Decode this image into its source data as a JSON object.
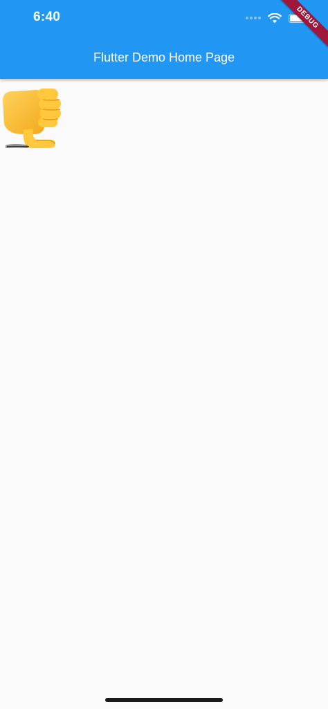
{
  "status_bar": {
    "time": "6:40",
    "icons": [
      "cellular-dots-icon",
      "wifi-icon",
      "battery-icon"
    ]
  },
  "app_bar": {
    "title": "Flutter Demo Home Page",
    "background": "#2196F3"
  },
  "debug_banner": {
    "label": "DEBUG",
    "color": "#A0173B"
  },
  "content": {
    "emoji": "thumbs-down-icon"
  }
}
